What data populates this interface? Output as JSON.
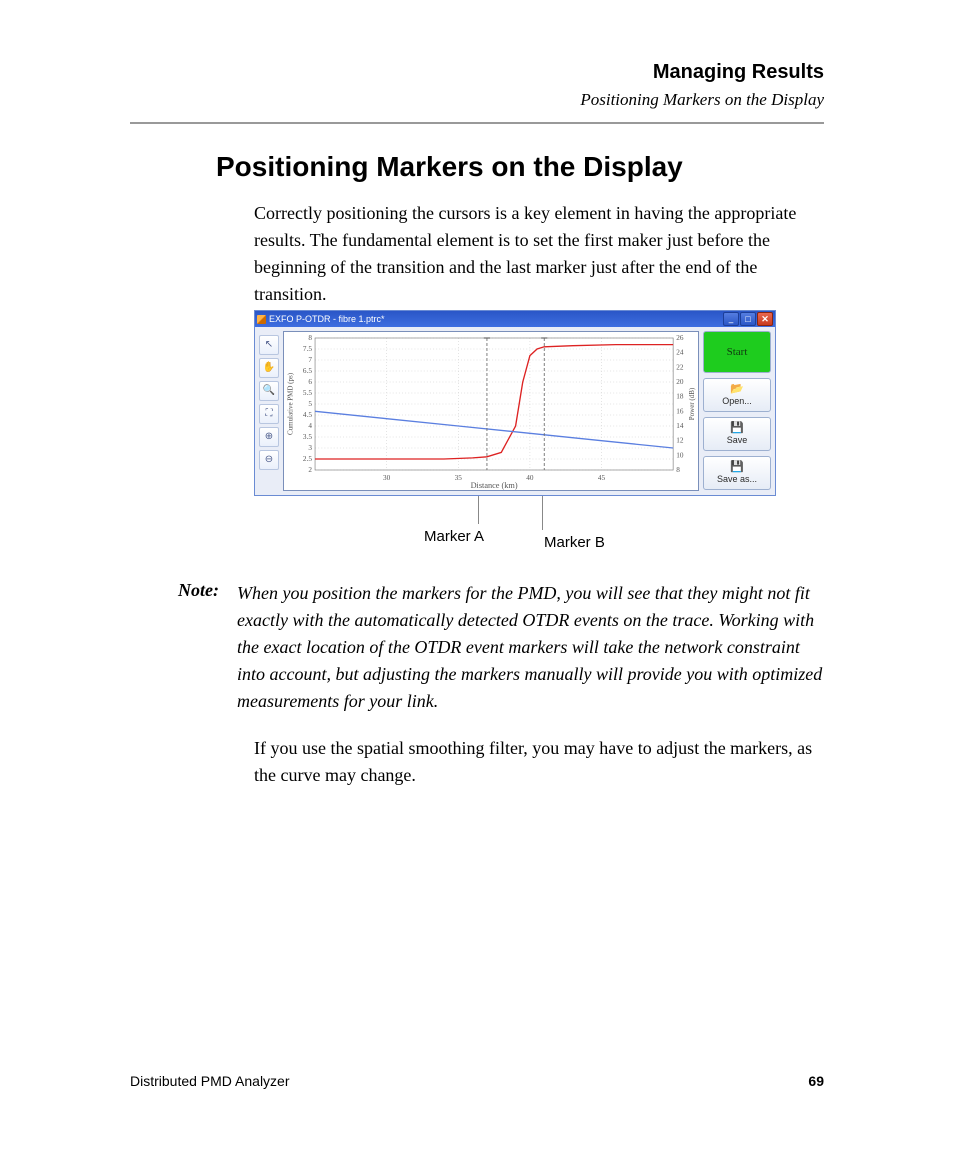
{
  "header": {
    "chapter": "Managing Results",
    "section": "Positioning Markers on the Display"
  },
  "title": "Positioning Markers on the Display",
  "paragraphs": {
    "intro": "Correctly positioning the cursors is a key element in having the appropriate results. The fundamental element is to set the first maker just before the beginning of the transition and the last marker just after the end of the transition.",
    "after_note": "If you use the spatial smoothing filter, you may have to adjust the markers, as the curve may change."
  },
  "note": {
    "label": "Note:",
    "text": "When you position the markers for the PMD, you will see that they might not fit exactly with the automatically detected OTDR events on the trace. Working with the exact location of the OTDR event markers will take the network constraint into account, but adjusting the markers manually will provide you with optimized measurements for your link."
  },
  "screenshot": {
    "window_title": "EXFO P-OTDR - fibre 1.ptrc*",
    "toolbar_icons": [
      "pointer-icon",
      "hand-icon",
      "zoom-icon",
      "zoom-window-icon",
      "zoom-in-icon",
      "zoom-out-icon"
    ],
    "sidebar": {
      "start": "Start",
      "open": "Open...",
      "save": "Save",
      "save_as": "Save as..."
    },
    "callouts": {
      "a": "Marker A",
      "b": "Marker B"
    }
  },
  "chart_data": {
    "type": "line",
    "xlabel": "Distance (km)",
    "ylabel_left": "Cumulative PMD (ps)",
    "ylabel_right": "Power (dB)",
    "xlim": [
      25,
      50
    ],
    "ylim_left": [
      2,
      8
    ],
    "ylim_right": [
      8,
      26
    ],
    "xticks": [
      30,
      35,
      40,
      45
    ],
    "yticks_left": [
      2,
      2.5,
      3,
      3.5,
      4,
      4.5,
      5,
      5.5,
      6,
      6.5,
      7,
      7.5,
      8
    ],
    "yticks_right": [
      8,
      10,
      12,
      14,
      16,
      18,
      20,
      22,
      24,
      26
    ],
    "markers": {
      "a_x": 37,
      "b_x": 41
    },
    "series": [
      {
        "name": "Cumulative PMD",
        "axis": "left",
        "color": "#d22",
        "x": [
          25,
          30,
          34,
          36,
          37,
          38,
          39,
          39.5,
          40,
          40.5,
          41,
          43,
          46,
          50
        ],
        "y": [
          2.5,
          2.5,
          2.5,
          2.55,
          2.6,
          2.8,
          4.0,
          6.0,
          7.2,
          7.5,
          7.6,
          7.65,
          7.7,
          7.7
        ]
      },
      {
        "name": "Power",
        "axis": "right",
        "color": "#5b7fe0",
        "x": [
          25,
          30,
          35,
          40,
          45,
          50
        ],
        "y": [
          16.0,
          15.0,
          14.0,
          13.0,
          12.0,
          11.0
        ]
      }
    ]
  },
  "footer": {
    "product": "Distributed PMD Analyzer",
    "page": "69"
  }
}
